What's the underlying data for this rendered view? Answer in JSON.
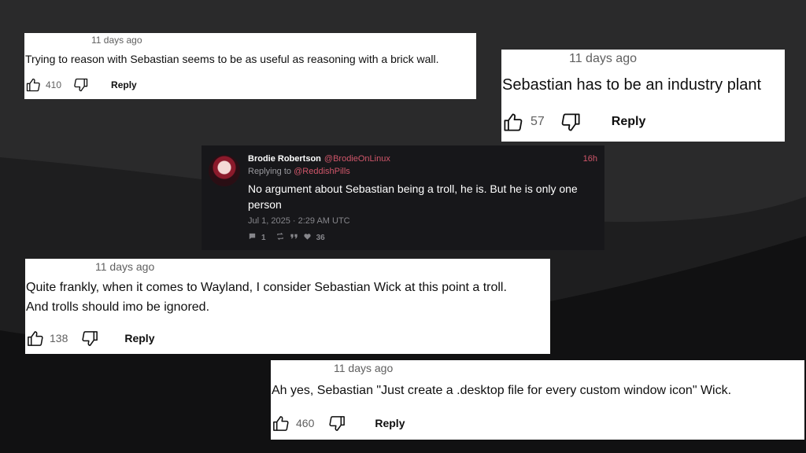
{
  "comments": [
    {
      "age": "11 days ago",
      "text": "Trying to reason with Sebastian seems to be as useful as reasoning with a brick wall.",
      "likes": "410",
      "reply_label": "Reply"
    },
    {
      "age": "11 days ago",
      "text": "Sebastian has to be an industry plant",
      "likes": "57",
      "reply_label": "Reply"
    },
    {
      "age": "11 days ago",
      "text_lines": [
        "Quite frankly, when it comes to Wayland, I consider Sebastian Wick at this point a troll.",
        "And trolls should imo be ignored."
      ],
      "likes": "138",
      "reply_label": "Reply"
    },
    {
      "age": "11 days ago",
      "text": "Ah yes, Sebastian \"Just create a .desktop file for every custom window icon\" Wick.",
      "likes": "460",
      "reply_label": "Reply"
    }
  ],
  "tweet": {
    "author": "Brodie Robertson",
    "handle": "@BrodieOnLinux",
    "time": "16h",
    "replying_prefix": "Replying to",
    "replying_handle": "@ReddishPills",
    "text": "No argument about Sebastian being a troll, he is. But he is only one person",
    "date": "Jul 1, 2025 · 2:29 AM UTC",
    "replies": "1",
    "likes": "36"
  },
  "icons": {
    "like": "thumbs-up-icon",
    "dislike": "thumbs-down-icon",
    "comment": "comment-icon",
    "retweet": "retweet-icon",
    "quote": "quote-icon",
    "heart": "heart-icon"
  },
  "colors": {
    "background": "#222223",
    "card": "#ffffff",
    "tweet_bg": "#17171a",
    "tweet_accent": "#d0566a"
  }
}
